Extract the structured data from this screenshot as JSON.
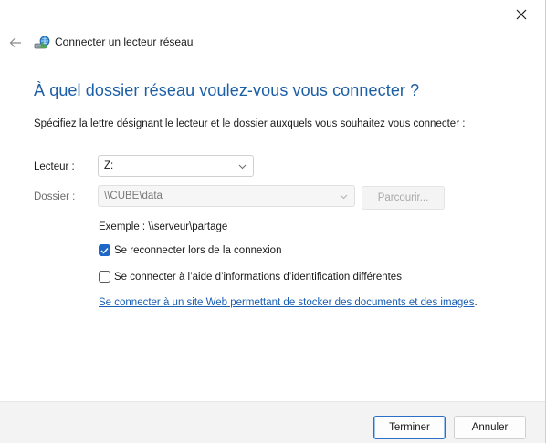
{
  "window": {
    "title": "Connecter un lecteur réseau",
    "close_icon": "close-icon",
    "back_icon": "back-arrow-icon",
    "app_icon": "network-drive-icon"
  },
  "main": {
    "heading": "À quel dossier réseau voulez-vous vous connecter ?",
    "instruction": "Spécifiez la lettre désignant le lecteur et le dossier auxquels vous souhaitez vous connecter :"
  },
  "form": {
    "drive_label": "Lecteur :",
    "drive_value": "Z:",
    "folder_label": "Dossier :",
    "folder_value": "\\\\CUBE\\data",
    "browse_label": "Parcourir...",
    "example_text": "Exemple : \\\\serveur\\partage",
    "reconnect_label": "Se reconnecter lors de la connexion",
    "reconnect_checked": true,
    "other_credentials_label": "Se connecter à l’aide d’informations d’identification différentes",
    "other_credentials_checked": false,
    "link_text": "Se connecter à un site Web permettant de stocker des documents et des images",
    "link_suffix": "."
  },
  "footer": {
    "finish_label": "Terminer",
    "cancel_label": "Annuler"
  },
  "colors": {
    "accent": "#1f67c7",
    "heading": "#1c5fa6",
    "link": "#1a5fb4",
    "footer_bg": "#f3f3f3"
  }
}
